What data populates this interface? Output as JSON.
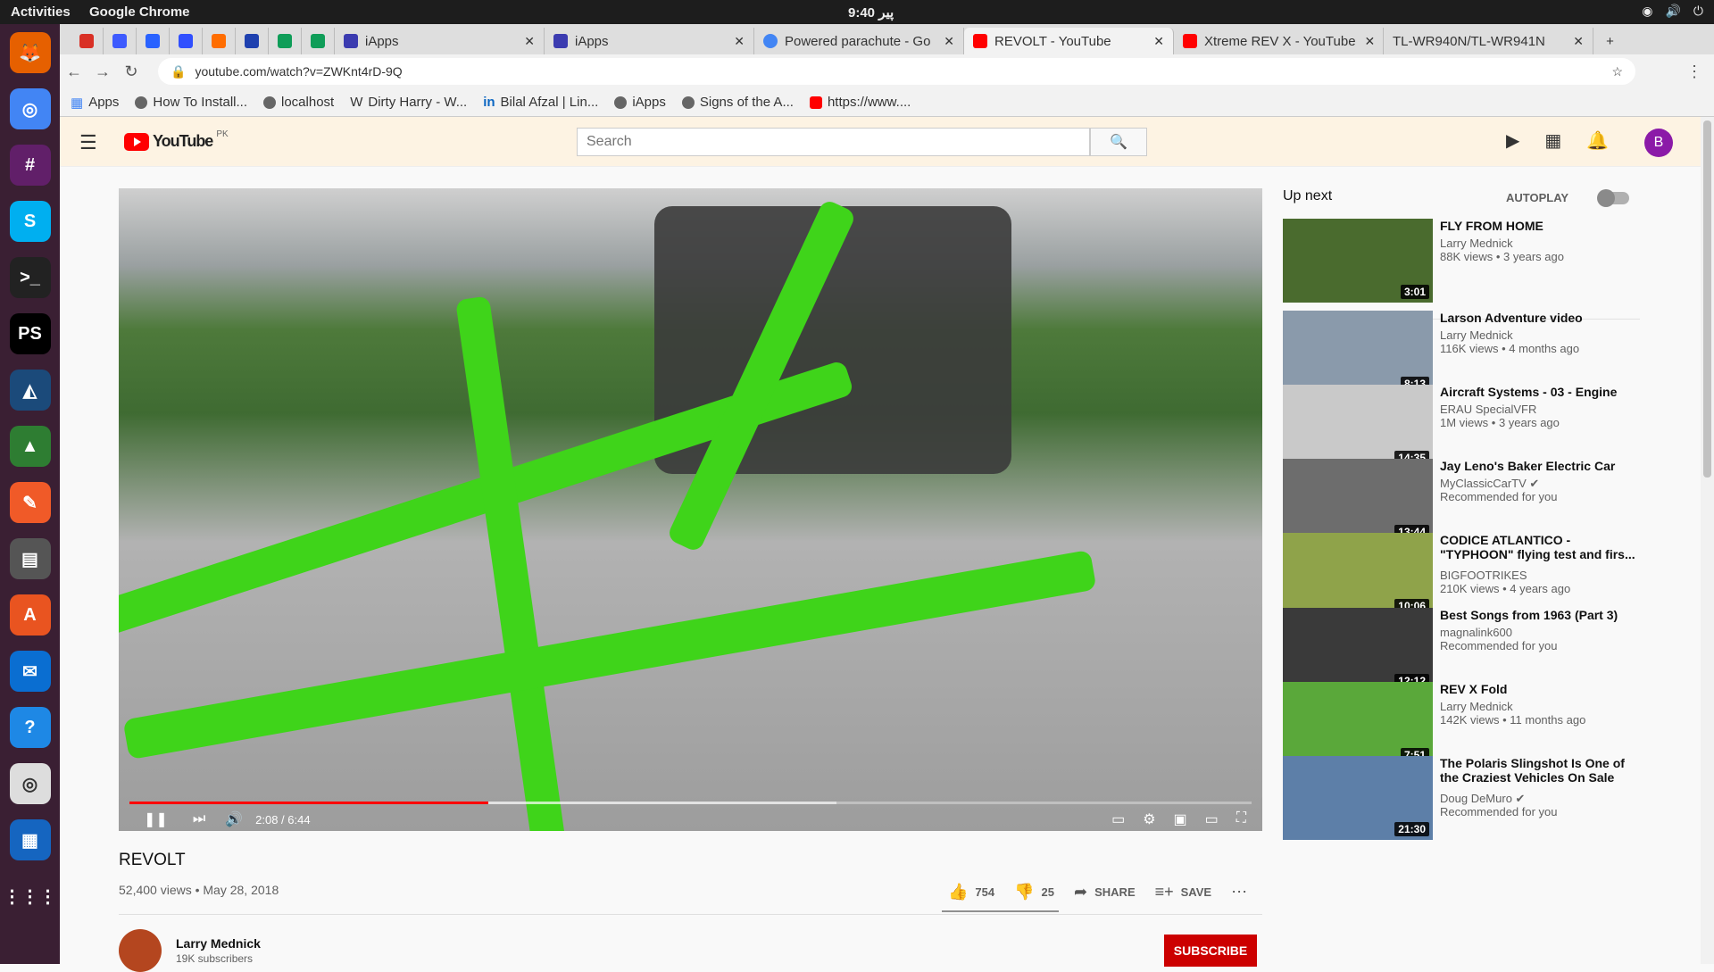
{
  "os": {
    "activities": "Activities",
    "app": "Google Chrome",
    "clock": "9:40 پیر"
  },
  "tabs": [
    {
      "title": "iApps",
      "color": "#3b3bb0"
    },
    {
      "title": "iApps",
      "color": "#3b3bb0"
    },
    {
      "title": "Powered parachute - Go",
      "color": "#4285f4"
    },
    {
      "title": "REVOLT - YouTube",
      "color": "#ff0000",
      "active": true
    },
    {
      "title": "Xtreme REV X - YouTube",
      "color": "#ff0000"
    },
    {
      "title": "TL-WR940N/TL-WR941N",
      "color": "#888888"
    }
  ],
  "url": "youtube.com/watch?v=ZWKnt4rD-9Q",
  "bookmarks": [
    "Apps",
    "How To Install...",
    "localhost",
    "Dirty Harry - W...",
    "Bilal Afzal | Lin...",
    "iApps",
    "Signs of the A...",
    "https://www...."
  ],
  "yt": {
    "region": "PK",
    "logo": "YouTube",
    "search_placeholder": "Search",
    "avatar": "B",
    "video": {
      "time": "2:08 / 6:44",
      "progress": 0.32,
      "buffered": 0.63,
      "title": "REVOLT",
      "meta": "52,400 views • May 28, 2018",
      "likes": "754",
      "dislikes": "25",
      "share": "SHARE",
      "save": "SAVE",
      "channel": "Larry Mednick",
      "subs": "19K subscribers",
      "subscribe": "SUBSCRIBE"
    },
    "upnext": {
      "header": "Up next",
      "autoplay": "AUTOPLAY",
      "items": [
        {
          "title": "FLY FROM HOME",
          "channel": "Larry Mednick",
          "views": "88K views • 3 years ago",
          "dur": "3:01",
          "bg": "#4a6b2e"
        },
        {
          "title": "Larson Adventure video",
          "channel": "Larry Mednick",
          "views": "116K views • 4 months ago",
          "dur": "8:13",
          "bg": "#8a9aab"
        },
        {
          "title": "Aircraft Systems - 03 - Engine",
          "channel": "ERAU SpecialVFR",
          "views": "1M views • 3 years ago",
          "dur": "14:35",
          "bg": "#c9c9c9"
        },
        {
          "title": "Jay Leno's Baker Electric Car",
          "channel": "MyClassicCarTV ✔",
          "views": "Recommended for you",
          "dur": "13:44",
          "bg": "#6d6d6d"
        },
        {
          "title": "CODICE ATLANTICO - \"TYPHOON\" flying test and firs...",
          "channel": "BIGFOOTRIKES",
          "views": "210K views • 4 years ago",
          "dur": "10:06",
          "bg": "#8fa34a"
        },
        {
          "title": "Best Songs from 1963 (Part 3)",
          "channel": "magnalink600",
          "views": "Recommended for you",
          "dur": "12:12",
          "bg": "#3a3a3a"
        },
        {
          "title": "REV X Fold",
          "channel": "Larry Mednick",
          "views": "142K views • 11 months ago",
          "dur": "7:51",
          "bg": "#5aa83a"
        },
        {
          "title": "The Polaris Slingshot Is One of the Craziest Vehicles On Sale",
          "channel": "Doug DeMuro ✔",
          "views": "Recommended for you",
          "dur": "21:30",
          "bg": "#5d7fa8"
        }
      ]
    }
  }
}
